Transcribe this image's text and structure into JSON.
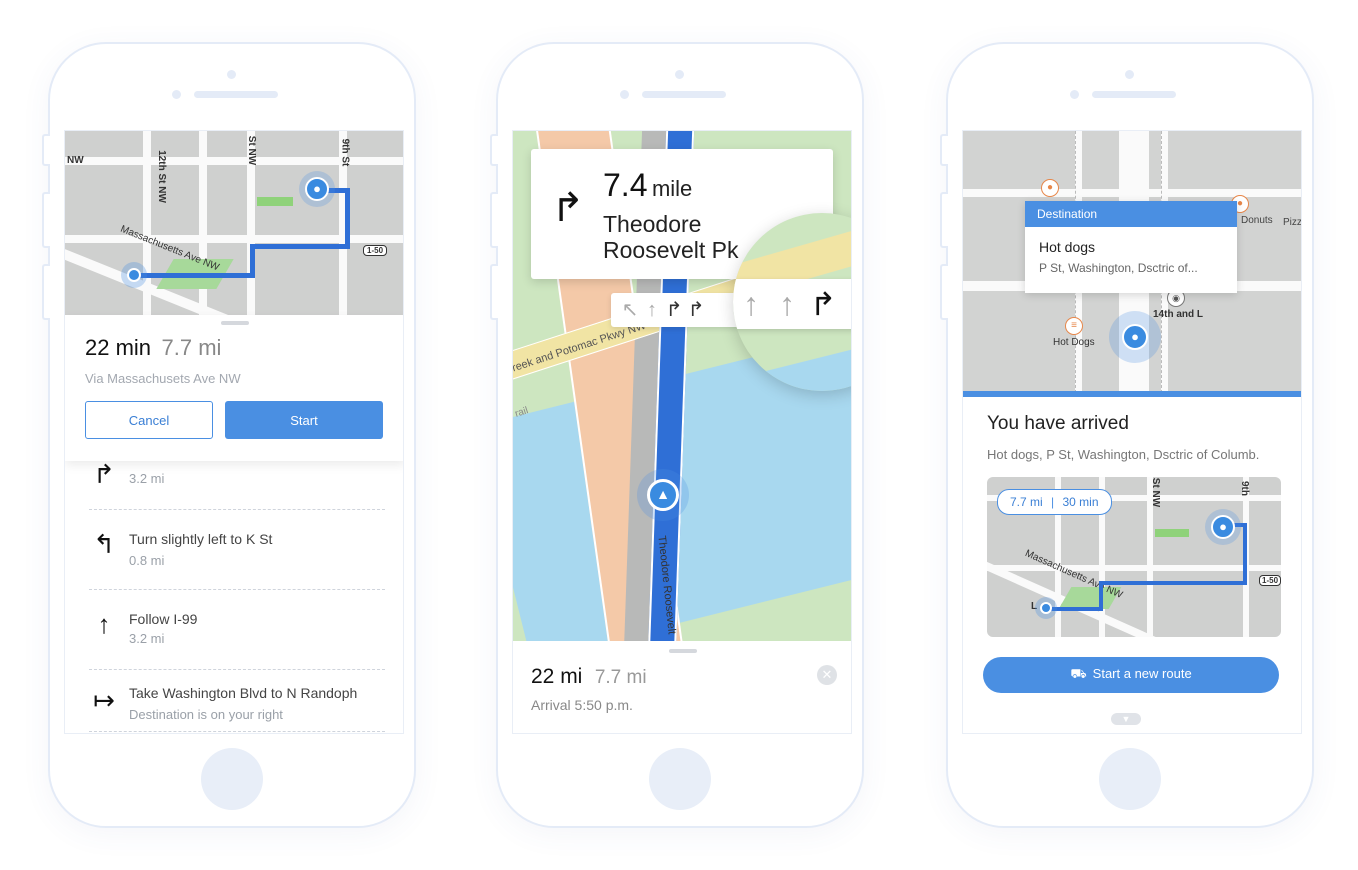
{
  "screen1": {
    "map_labels": [
      "NW",
      "12th St NW",
      "St NW",
      "9th St",
      "Massachusetts Ave NW",
      "1-50"
    ],
    "summary": {
      "duration": "22 min",
      "distance": "7.7 mi",
      "via": "Via Massachusets Ave NW"
    },
    "cancel_label": "Cancel",
    "start_label": "Start",
    "steps": [
      {
        "icon": "turn-right-icon",
        "title": "",
        "dist": "3.2 mi"
      },
      {
        "icon": "turn-slight-left-icon",
        "title": "Turn slightly left to K St",
        "dist": "0.8 mi"
      },
      {
        "icon": "straight-arrow-icon",
        "title": "Follow I-99",
        "dist": "3.2 mi"
      },
      {
        "icon": "destination-right-icon",
        "title": "Take Washington Blvd to N Randoph",
        "dist": "Destination is on your right"
      }
    ]
  },
  "screen2": {
    "maneuver": {
      "distance": "7.4",
      "unit": "mile",
      "street_line1": "Theodore",
      "street_line2": "Roosevelt Pk"
    },
    "map_labels": [
      "reek and Potomac Pkwy NW",
      "Theodore Roosevelt",
      "rail"
    ],
    "summary": {
      "distance": "22 mi",
      "alt": "7.7 mi",
      "arrival": "Arrival 5:50 p.m."
    }
  },
  "screen3": {
    "popup": {
      "header": "Destination",
      "title": "Hot dogs",
      "address": "P St, Washington, Dsctric of..."
    },
    "map_labels": [
      "Donuts",
      "Pizz",
      "14th and L",
      "Hot Dogs"
    ],
    "arrived_title": "You have arrived",
    "arrived_address": "Hot dogs, P St, Washington, Dsctric of Columb.",
    "mini_badge": {
      "distance": "7.7 mi",
      "time": "30 min"
    },
    "mini_labels": [
      "Massachusetts Ave NW",
      "1-50",
      "9th",
      "St NW",
      "L"
    ],
    "new_route_label": "Start a new route"
  },
  "colors": {
    "accent": "#4a8fe2",
    "route": "#2f6fd6",
    "water": "#a8d8ef",
    "park": "#cfe3c0",
    "highway": "#f4c9a8"
  }
}
